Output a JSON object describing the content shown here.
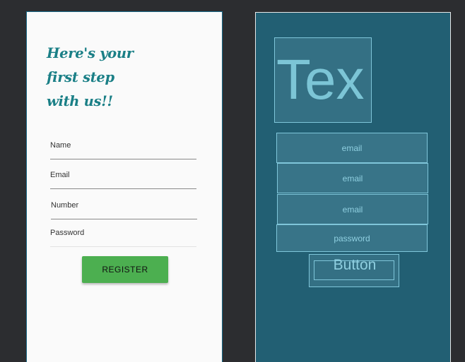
{
  "design": {
    "heading_lines": [
      "Here's your",
      "first step",
      "with us!!"
    ],
    "fields": [
      {
        "label": "Name"
      },
      {
        "label": "Email"
      },
      {
        "label": "Number"
      },
      {
        "label": "Password"
      }
    ],
    "register_label": "REGISTER"
  },
  "blueprint": {
    "textview_text": "Tex",
    "inputs": [
      "email",
      "email",
      "email",
      "password"
    ],
    "button_label": "Button"
  },
  "colors": {
    "heading": "#1a7f86",
    "register_button": "#4caf50",
    "blueprint_bg": "#225f73",
    "blueprint_outline": "#7fc6da",
    "workspace_bg": "#2c2d30"
  }
}
